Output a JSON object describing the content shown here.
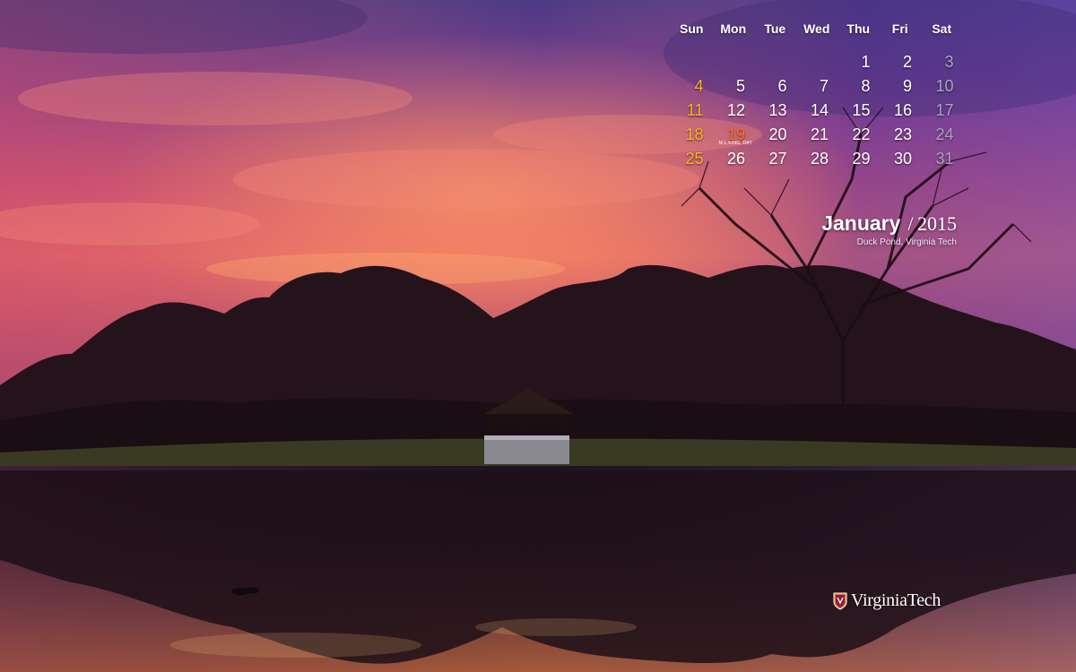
{
  "calendar": {
    "weekdays": [
      "Sun",
      "Mon",
      "Tue",
      "Wed",
      "Thu",
      "Fri",
      "Sat"
    ],
    "weeks": [
      [
        "",
        "",
        "",
        "",
        "1",
        "2",
        "3"
      ],
      [
        "4",
        "5",
        "6",
        "7",
        "8",
        "9",
        "10"
      ],
      [
        "11",
        "12",
        "13",
        "14",
        "15",
        "16",
        "17"
      ],
      [
        "18",
        "19",
        "20",
        "21",
        "22",
        "23",
        "24"
      ],
      [
        "25",
        "26",
        "27",
        "28",
        "29",
        "30",
        "31"
      ]
    ],
    "holiday": {
      "day": "19",
      "label": "M.L.KING, DAY"
    }
  },
  "caption": {
    "month": "January",
    "separator": "/",
    "year": "2015",
    "place": "Duck Pond, Virginia Tech"
  },
  "brand": {
    "name": "VirginiaTech"
  },
  "colors": {
    "weekday_text": "#ffffff",
    "sunday": "#ffb01e",
    "saturday": "#a8a6b8",
    "holiday": "#ff6a1a",
    "sky_top": "#5a3a86",
    "sky_glow": "#e4606a",
    "water": "#2a1a2c",
    "logo_maroon": "#861f41",
    "logo_orange": "#e5751f"
  }
}
